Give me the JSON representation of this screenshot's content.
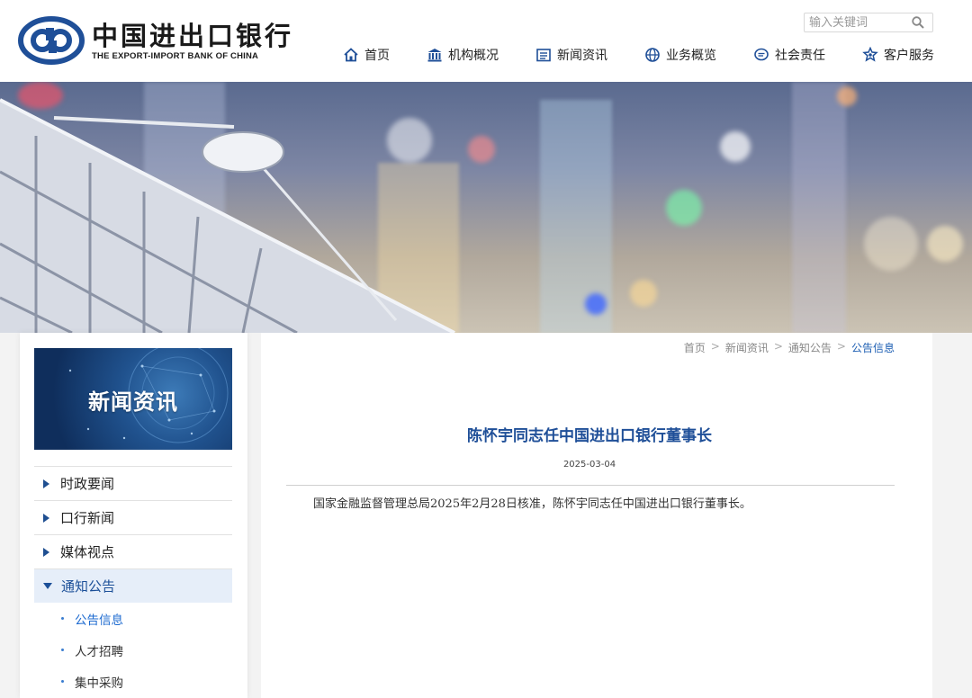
{
  "header": {
    "logo_cn": "中国进出口银行",
    "logo_en": "THE EXPORT-IMPORT BANK OF CHINA",
    "search_placeholder": "输入关键词"
  },
  "nav": {
    "items": [
      {
        "label": "首页",
        "icon": "home-icon"
      },
      {
        "label": "机构概况",
        "icon": "bank-building-icon"
      },
      {
        "label": "新闻资讯",
        "icon": "news-icon"
      },
      {
        "label": "业务概览",
        "icon": "globe-icon"
      },
      {
        "label": "社会责任",
        "icon": "chat-bubble-icon"
      },
      {
        "label": "客户服务",
        "icon": "star-shield-icon"
      }
    ]
  },
  "sidebar": {
    "banner_title": "新闻资讯",
    "items": [
      {
        "label": "时政要闻"
      },
      {
        "label": "口行新闻"
      },
      {
        "label": "媒体视点"
      },
      {
        "label": "通知公告"
      }
    ],
    "sub_items": [
      {
        "label": "公告信息"
      },
      {
        "label": "人才招聘"
      },
      {
        "label": "集中采购"
      }
    ]
  },
  "breadcrumb": {
    "items": [
      "首页",
      "新闻资讯",
      "通知公告",
      "公告信息"
    ],
    "separator": ">"
  },
  "article": {
    "title": "陈怀宇同志任中国进出口银行董事长",
    "date": "2025-03-04",
    "body": "国家金融监督管理总局2025年2月28日核准，陈怀宇同志任中国进出口银行董事长。"
  },
  "colors": {
    "brand_blue": "#1f4f98",
    "link_blue": "#1e6bd0",
    "active_bg": "#e6eef9"
  }
}
